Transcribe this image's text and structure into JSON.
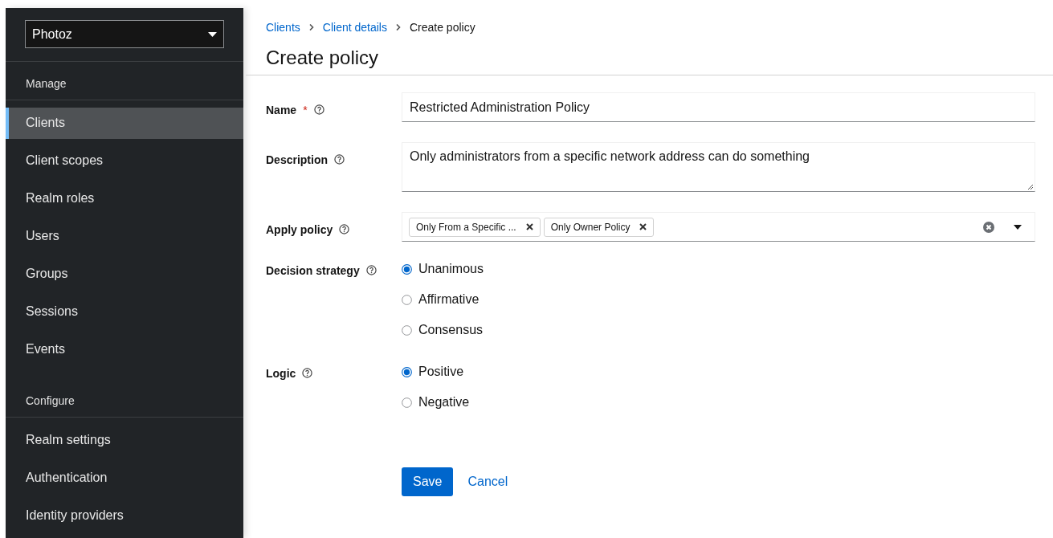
{
  "sidebar": {
    "realm_selector": {
      "value": "Photoz"
    },
    "sections": [
      {
        "title": "Manage",
        "items": [
          {
            "label": "Clients",
            "selected": true
          },
          {
            "label": "Client scopes",
            "selected": false
          },
          {
            "label": "Realm roles",
            "selected": false
          },
          {
            "label": "Users",
            "selected": false
          },
          {
            "label": "Groups",
            "selected": false
          },
          {
            "label": "Sessions",
            "selected": false
          },
          {
            "label": "Events",
            "selected": false
          }
        ]
      },
      {
        "title": "Configure",
        "items": [
          {
            "label": "Realm settings",
            "selected": false
          },
          {
            "label": "Authentication",
            "selected": false
          },
          {
            "label": "Identity providers",
            "selected": false
          }
        ]
      }
    ]
  },
  "breadcrumbs": [
    {
      "label": "Clients",
      "kind": "link"
    },
    {
      "label": "Client details",
      "kind": "link"
    },
    {
      "label": "Create policy",
      "kind": "current"
    }
  ],
  "title": "Create policy",
  "form": [
    {
      "kind": "text",
      "label": "Name",
      "required_mark": "*",
      "value": "Restricted Administration Policy"
    },
    {
      "kind": "textarea",
      "label": "Description",
      "value": "Only administrators from a specific network address can do something"
    },
    {
      "kind": "chips",
      "label": "Apply policy",
      "chips": [
        "Only From a Specific ...",
        "Only Owner Policy"
      ]
    },
    {
      "kind": "radio",
      "label": "Decision strategy",
      "options": [
        {
          "label": "Unanimous",
          "selected": true
        },
        {
          "label": "Affirmative",
          "selected": false
        },
        {
          "label": "Consensus",
          "selected": false
        }
      ]
    },
    {
      "kind": "radio",
      "label": "Logic",
      "options": [
        {
          "label": "Positive",
          "selected": true
        },
        {
          "label": "Negative",
          "selected": false
        }
      ]
    }
  ],
  "actions": {
    "save": "Save",
    "cancel": "Cancel"
  }
}
